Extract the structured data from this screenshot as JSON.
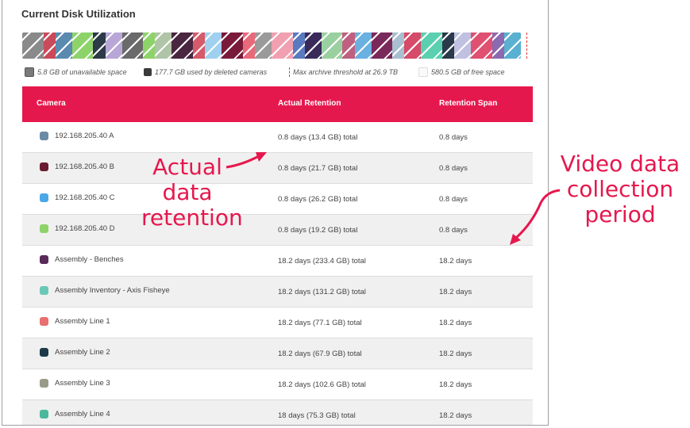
{
  "panel": {
    "title": "Current Disk Utilization"
  },
  "usage_bar": {
    "segments": [
      "#8a8a8a",
      "#c94a5a",
      "#5b8ab0",
      "#8ed36a",
      "#2d3a48",
      "#b8a7d6",
      "#6a6a6a",
      "#8ed36a",
      "#b0c4a8",
      "#4a2640",
      "#d65a6a",
      "#a0d0f0",
      "#7a1a3a",
      "#e86a7a",
      "#9a9a9a",
      "#f0a0b0",
      "#5a7ac0",
      "#3a2a5a",
      "#9ad0a0",
      "#c06080",
      "#6ab0e0",
      "#7a2a5a",
      "#a8c0d0",
      "#d64a6a",
      "#5ad0b0",
      "#2a3a4a",
      "#c0c0e0",
      "#e05070",
      "#8a6ab0",
      "#5ab0d0"
    ],
    "threshold_color": "#e53935"
  },
  "legend": {
    "unavailable": "5.8 GB of unavailable space",
    "deleted": "177.7 GB used by deleted cameras",
    "threshold": "Max archive threshold at 26.9 TB",
    "free": "580.5 GB of free space"
  },
  "table": {
    "headers": {
      "camera": "Camera",
      "actual": "Actual Retention",
      "span": "Retention Span"
    },
    "rows": [
      {
        "name": "192.168.205.40 A",
        "actual": "0.8 days (13.4 GB) total",
        "span": "0.8 days",
        "color": "#6a8aa6"
      },
      {
        "name": "192.168.205.40 B",
        "actual": "0.8 days (21.7 GB) total",
        "span": "0.8 days",
        "color": "#6a1a30"
      },
      {
        "name": "192.168.205.40 C",
        "actual": "0.8 days (26.2 GB) total",
        "span": "0.8 days",
        "color": "#4aa8e8"
      },
      {
        "name": "192.168.205.40 D",
        "actual": "0.8 days (19.2 GB) total",
        "span": "0.8 days",
        "color": "#8ed36a"
      },
      {
        "name": "Assembly - Benches",
        "actual": "18.2 days (233.4 GB) total",
        "span": "18.2 days",
        "color": "#5a2a5a"
      },
      {
        "name": "Assembly Inventory - Axis Fisheye",
        "actual": "18.2 days (131.2 GB) total",
        "span": "18.2 days",
        "color": "#6ac8b8"
      },
      {
        "name": "Assembly Line 1",
        "actual": "18.2 days (77.1 GB) total",
        "span": "18.2 days",
        "color": "#e87070"
      },
      {
        "name": "Assembly Line 2",
        "actual": "18.2 days (67.9 GB) total",
        "span": "18.2 days",
        "color": "#1a3a4a"
      },
      {
        "name": "Assembly Line 3",
        "actual": "18.2 days (102.6 GB) total",
        "span": "18.2 days",
        "color": "#9a9a88"
      },
      {
        "name": "Assembly Line 4",
        "actual": "18 days (75.3 GB) total",
        "span": "18.2 days",
        "color": "#4ab89a"
      }
    ]
  },
  "annotations": {
    "actual": [
      "Actual",
      "data",
      "retention"
    ],
    "video": [
      "Video data",
      "collection",
      "period"
    ],
    "color": "#e5184d"
  }
}
